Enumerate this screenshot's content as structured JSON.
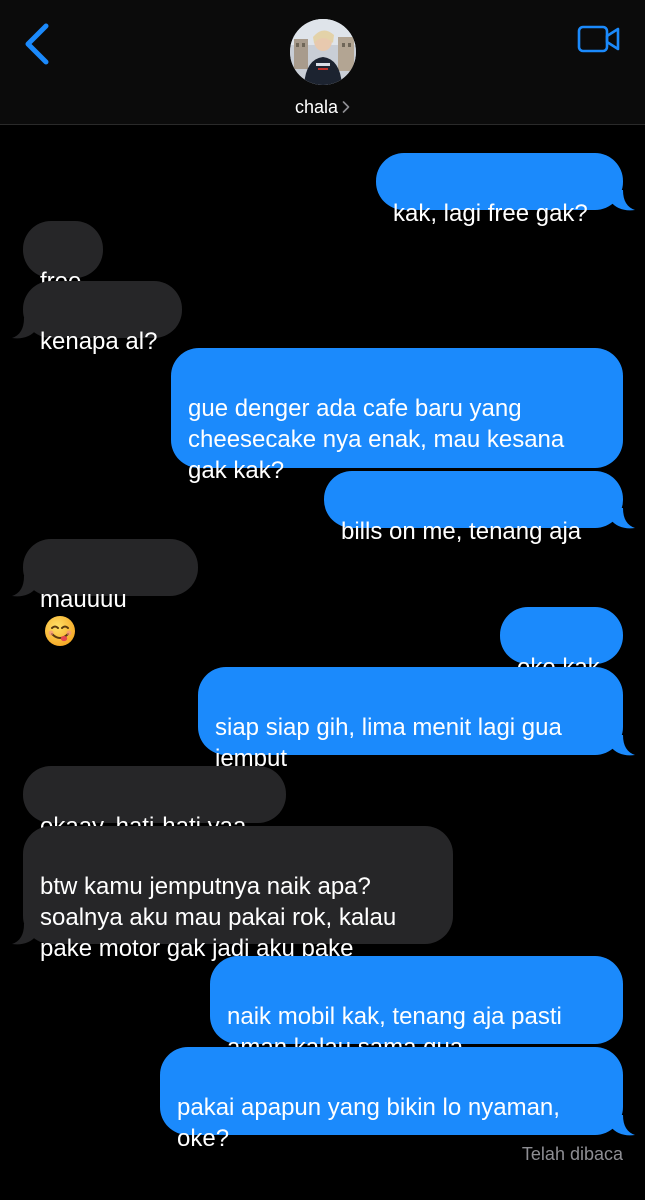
{
  "header": {
    "contact_name": "chala",
    "back_icon": "chevron-left-icon",
    "video_icon": "video-camera-icon",
    "accent_color": "#1b8afc"
  },
  "messages": [
    {
      "from": "me",
      "text": "kak, lagi free gak?"
    },
    {
      "from": "them",
      "text": "free"
    },
    {
      "from": "them",
      "text": "kenapa al?"
    },
    {
      "from": "me",
      "text": "gue denger ada cafe baru yang\ncheesecake nya enak, mau kesana\ngak kak?"
    },
    {
      "from": "me",
      "text": "bills on me, tenang aja"
    },
    {
      "from": "them",
      "text": "mauuuu",
      "emoji": "face-savoring-food-icon"
    },
    {
      "from": "me",
      "text": "oke kak"
    },
    {
      "from": "me",
      "text": "siap siap gih, lima menit lagi gua\njemput"
    },
    {
      "from": "them",
      "text": "okaay, hati-hati yaa"
    },
    {
      "from": "them",
      "text": "btw kamu jemputnya naik apa?\nsoalnya aku mau pakai rok, kalau\npake motor gak jadi aku pake"
    },
    {
      "from": "me",
      "text": "naik mobil kak, tenang aja pasti\naman kalau sama gua"
    },
    {
      "from": "me",
      "text": "pakai apapun yang bikin lo nyaman,\noke?"
    }
  ],
  "read_receipt": "Telah dibaca",
  "colors": {
    "outgoing_bubble": "#1b8afc",
    "incoming_bubble": "#262628",
    "background": "#000000",
    "receipt_text": "#8e8e93"
  }
}
